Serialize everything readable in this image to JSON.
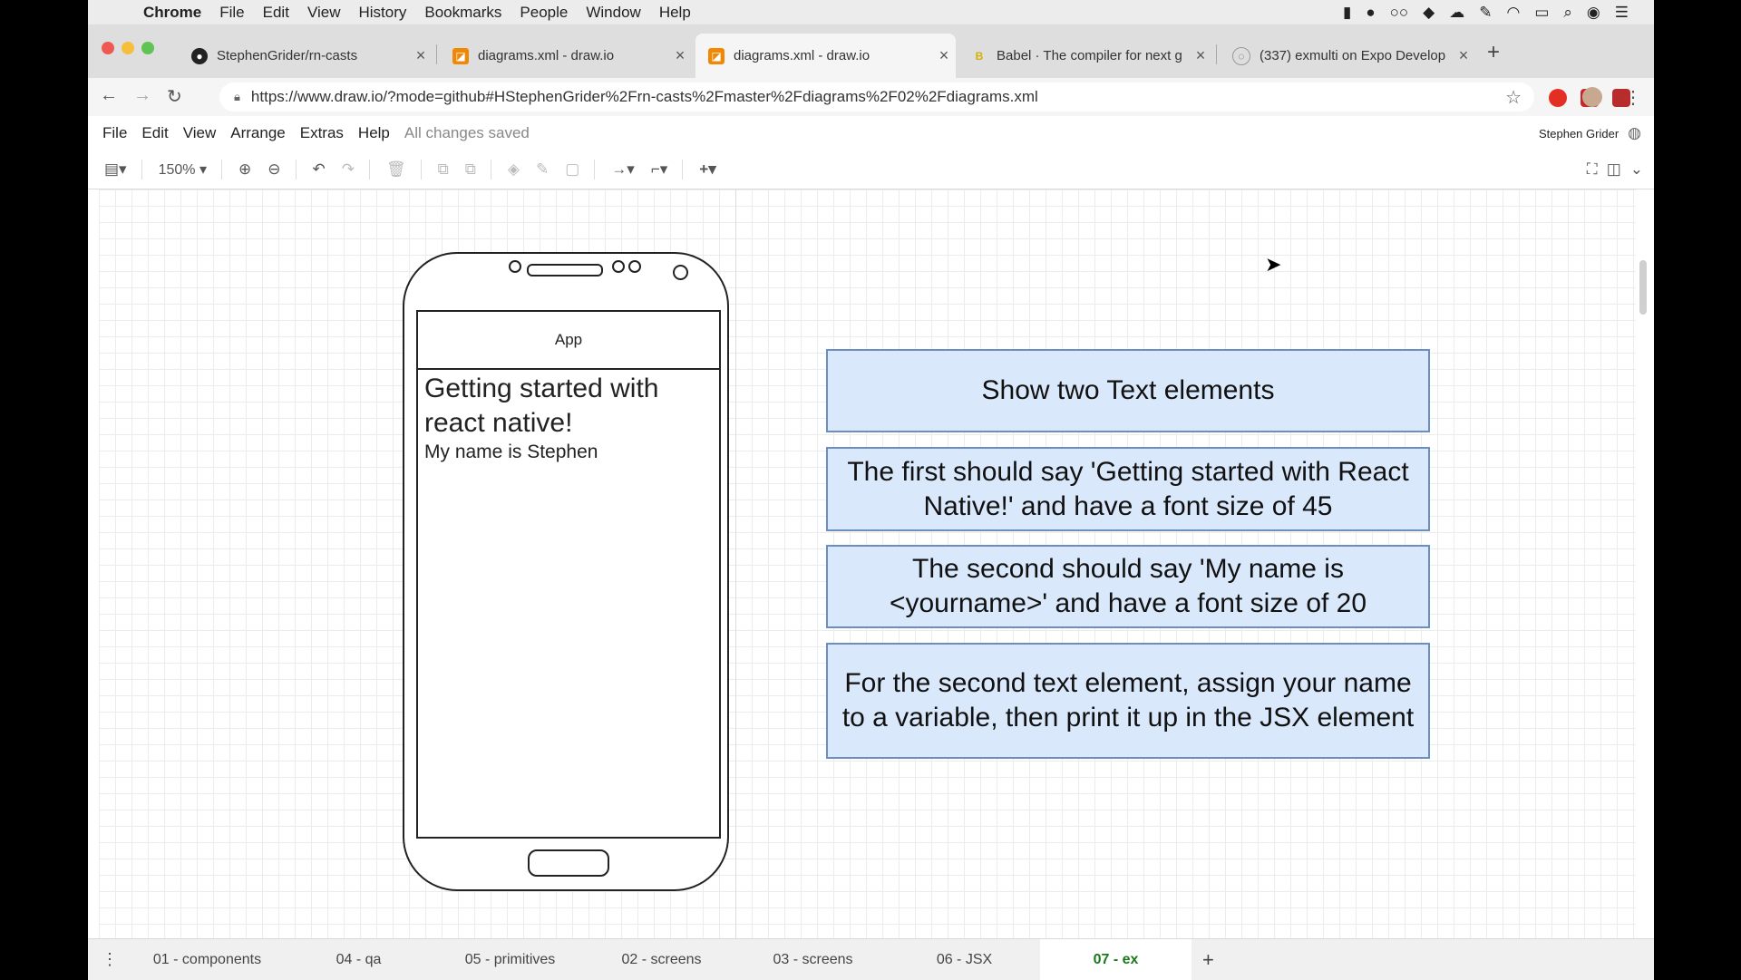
{
  "menubar": {
    "app": "Chrome",
    "items": [
      "File",
      "Edit",
      "View",
      "History",
      "Bookmarks",
      "People",
      "Window",
      "Help"
    ]
  },
  "tabs": [
    {
      "title": "StephenGrider/rn-casts",
      "icon": "github-icon",
      "active": false
    },
    {
      "title": "diagrams.xml - draw.io",
      "icon": "drawio-icon",
      "active": false
    },
    {
      "title": "diagrams.xml - draw.io",
      "icon": "drawio-icon",
      "active": true
    },
    {
      "title": "Babel · The compiler for next g",
      "icon": "babel-icon",
      "active": false
    },
    {
      "title": "(337) exmulti on Expo Develop",
      "icon": "expo-icon",
      "active": false
    }
  ],
  "address": {
    "url": "https://www.draw.io/?mode=github#HStephenGrider%2Frn-casts%2Fmaster%2Fdiagrams%2F02%2Fdiagrams.xml"
  },
  "drawio_menu": {
    "items": [
      "File",
      "Edit",
      "View",
      "Arrange",
      "Extras",
      "Help"
    ],
    "status": "All changes saved",
    "user": "Stephen Grider"
  },
  "toolbar": {
    "zoom": "150%"
  },
  "phone": {
    "header": "App",
    "title_text": "Getting started with react native!",
    "name_text": "My name is Stephen"
  },
  "notes": [
    "Show two Text elements",
    "The first should say 'Getting started with React Native!' and have a font size of 45",
    "The second should say 'My name is <yourname>' and have a font size of 20",
    "For the second text element, assign your name to a variable, then print it up in the JSX element"
  ],
  "pages": [
    {
      "label": "01 - components",
      "active": false
    },
    {
      "label": "04 - qa",
      "active": false
    },
    {
      "label": "05 - primitives",
      "active": false
    },
    {
      "label": "02 - screens",
      "active": false
    },
    {
      "label": "03 - screens",
      "active": false
    },
    {
      "label": "06 - JSX",
      "active": false
    },
    {
      "label": "07 - ex",
      "active": true
    }
  ],
  "colors": {
    "note_fill": "#dae8fc",
    "note_border": "#6c8ebf",
    "active_page": "#1a7a1a"
  }
}
